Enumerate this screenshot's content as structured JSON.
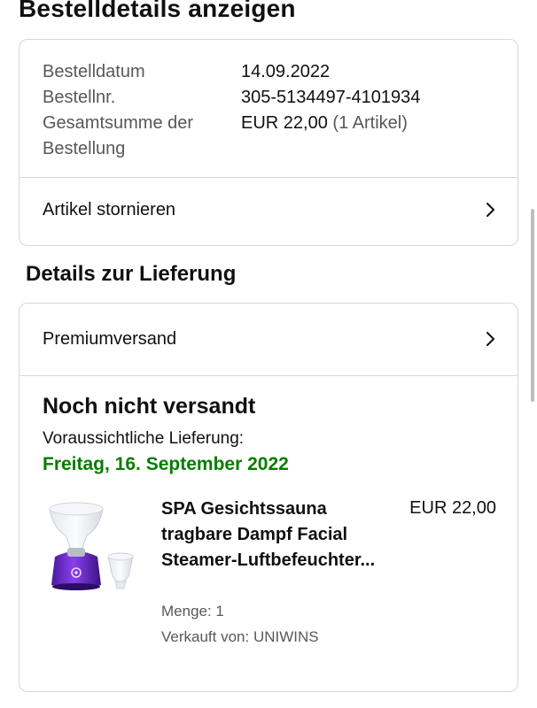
{
  "header": {
    "title": "Bestelldetails anzeigen"
  },
  "summary": {
    "date_label": "Bestelldatum",
    "date_value": "14.09.2022",
    "order_no_label": "Bestellnr.",
    "order_no_value": "305-5134497-4101934",
    "total_label": "Gesamtsumme der Bestellung",
    "total_value": "EUR 22,00",
    "total_items": "(1 Artikel)",
    "cancel_label": "Artikel stornieren"
  },
  "delivery": {
    "heading": "Details zur Lieferung",
    "shipping_method": "Premiumversand",
    "status": "Noch nicht versandt",
    "eta_label": "Voraussichtliche Lieferung:",
    "eta_date": "Freitag, 16. September 2022",
    "eta_color": "#067d00"
  },
  "item": {
    "title": "SPA Gesichtssauna tragbare Dampf Facial Steamer-Luftbefeuchter...",
    "price": "EUR 22,00",
    "quantity": "Menge: 1",
    "seller": "Verkauft von: UNIWINS"
  },
  "icons": {
    "chevron": "chevron-right-icon"
  }
}
